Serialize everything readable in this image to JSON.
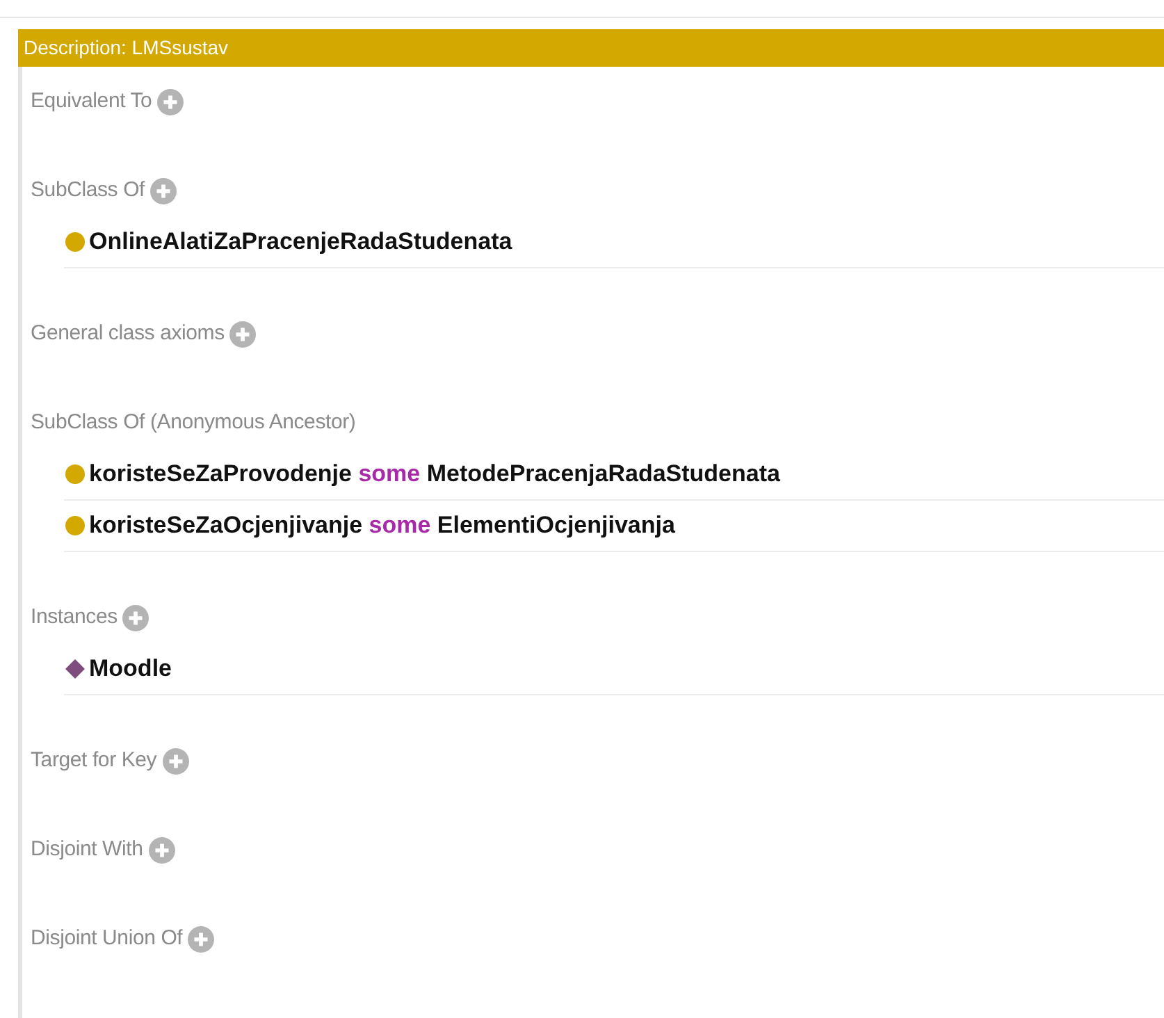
{
  "header": {
    "title": "Description: LMSsustav"
  },
  "sections": [
    {
      "label": "Equivalent To",
      "addable": true
    },
    {
      "label": "SubClass Of",
      "addable": true,
      "items": [
        {
          "kind": "class",
          "parts": [
            {
              "kind": "name",
              "text": "OnlineAlatiZaPracenjeRadaStudenata"
            }
          ]
        }
      ]
    },
    {
      "label": "General class axioms",
      "addable": true
    },
    {
      "label": "SubClass Of (Anonymous Ancestor)",
      "addable": false,
      "items": [
        {
          "kind": "class",
          "parts": [
            {
              "kind": "name",
              "text": "koristeSeZaProvodenje"
            },
            {
              "kind": "keyword",
              "text": "some"
            },
            {
              "kind": "name",
              "text": "MetodePracenjaRadaStudenata"
            }
          ]
        },
        {
          "kind": "class",
          "parts": [
            {
              "kind": "name",
              "text": "koristeSeZaOcjenjivanje"
            },
            {
              "kind": "keyword",
              "text": "some"
            },
            {
              "kind": "name",
              "text": "ElementiOcjenjivanja"
            }
          ]
        }
      ]
    },
    {
      "label": "Instances",
      "addable": true,
      "items": [
        {
          "kind": "individual",
          "parts": [
            {
              "kind": "name",
              "text": "Moodle"
            }
          ]
        }
      ]
    },
    {
      "label": "Target for Key",
      "addable": true
    },
    {
      "label": "Disjoint With",
      "addable": true
    },
    {
      "label": "Disjoint Union Of",
      "addable": true
    }
  ]
}
